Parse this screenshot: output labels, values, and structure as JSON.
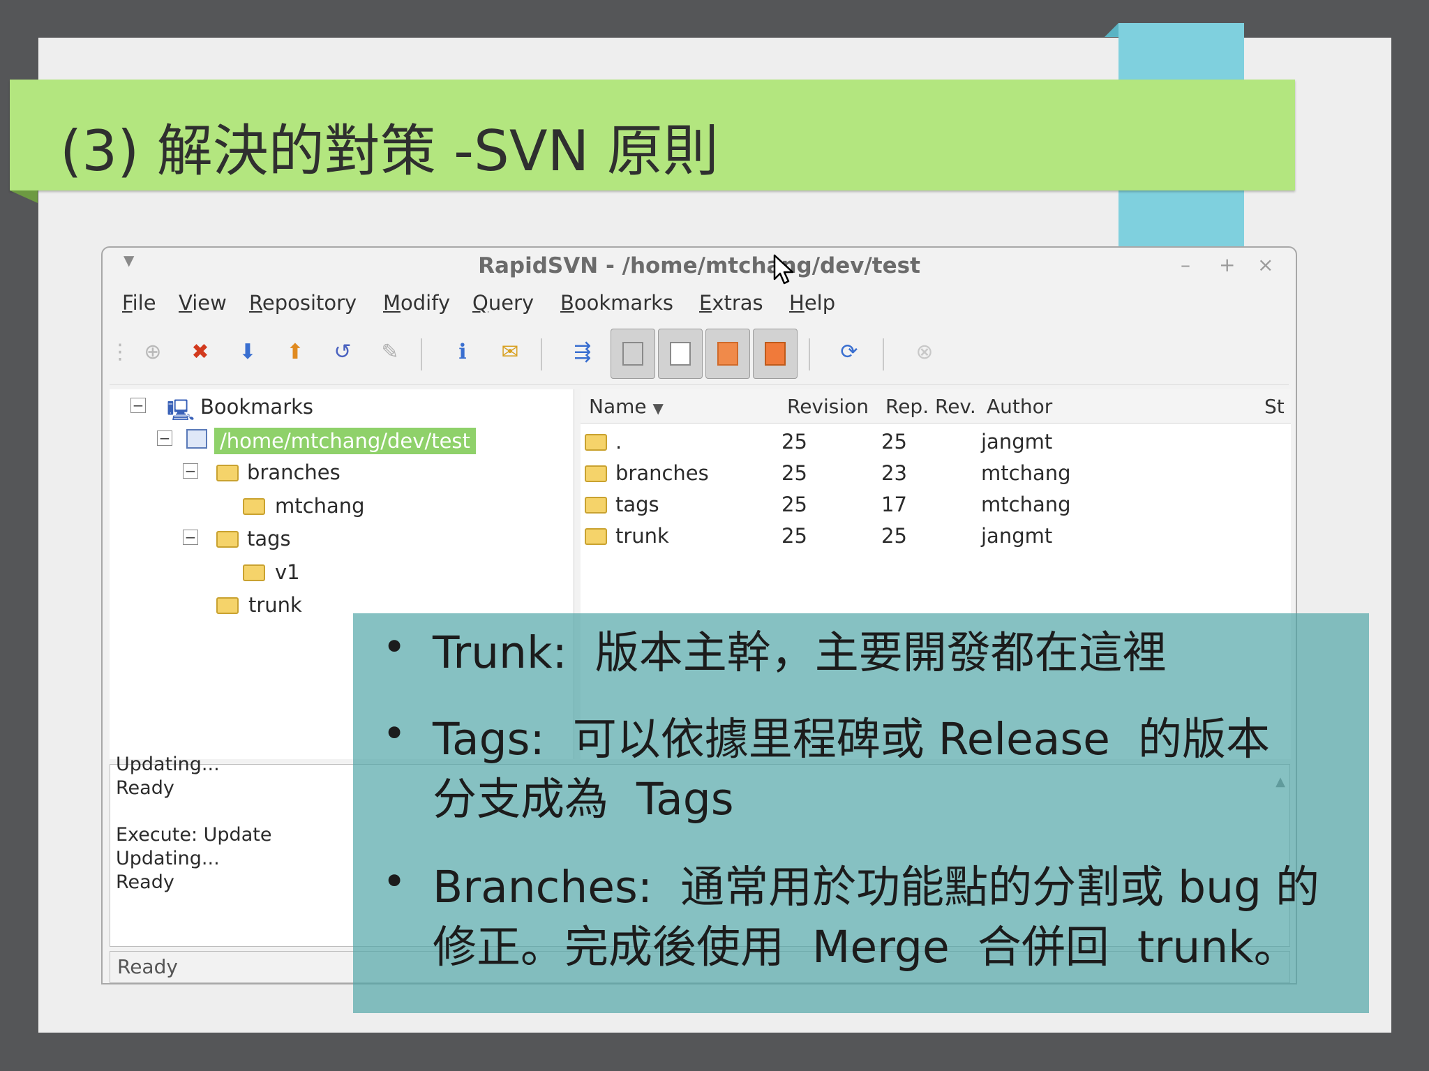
{
  "slide": {
    "title": "(3) 解決的對策 -SVN 原則"
  },
  "window": {
    "title": "RapidSVN - /home/mtchang/dev/test",
    "controls": {
      "minimize": "–",
      "maximize": "+",
      "close": "×"
    }
  },
  "menu": [
    {
      "ul": "F",
      "rest": "ile"
    },
    {
      "ul": "V",
      "rest": "iew"
    },
    {
      "ul": "R",
      "rest": "epository"
    },
    {
      "ul": "M",
      "rest": "odify"
    },
    {
      "ul": "Q",
      "rest": "uery"
    },
    {
      "ul": "B",
      "rest": "ookmarks"
    },
    {
      "ul": "E",
      "rest": "xtras"
    },
    {
      "ul": "H",
      "rest": "elp"
    }
  ],
  "tree": {
    "root": "Bookmarks",
    "bookmark": "/home/mtchang/dev/test",
    "branches": "branches",
    "branches_child": "mtchang",
    "tags": "tags",
    "tags_child": "v1",
    "trunk": "trunk"
  },
  "list": {
    "headers": {
      "name": "Name",
      "revision": "Revision",
      "rep_rev": "Rep. Rev.",
      "author": "Author",
      "status": "St"
    },
    "rows": [
      {
        "name": ".",
        "revision": "25",
        "rep_rev": "25",
        "author": "jangmt"
      },
      {
        "name": "branches",
        "revision": "25",
        "rep_rev": "23",
        "author": "mtchang"
      },
      {
        "name": "tags",
        "revision": "25",
        "rep_rev": "17",
        "author": "mtchang"
      },
      {
        "name": "trunk",
        "revision": "25",
        "rep_rev": "25",
        "author": "jangmt"
      }
    ]
  },
  "log": {
    "lines": [
      "Updating...",
      "Ready",
      "",
      "Execute: Update",
      "Updating...",
      "Ready"
    ]
  },
  "statusbar": {
    "text": "Ready"
  },
  "bullets": [
    {
      "line1": "Trunk:  版本主幹，主要開發都在這裡",
      "line2": ""
    },
    {
      "line1": "Tags:  可以依據里程碑或 Release  的版本",
      "line2": "分支成為  Tags"
    },
    {
      "line1": "Branches:  通常用於功能點的分割或 bug 的",
      "line2": "修正。完成後使用  Merge  合併回  trunk。"
    }
  ],
  "colors": {
    "title_bar": "#b3e67f",
    "accent_block": "#7fd0de",
    "overlay": "#4da3a5",
    "selection": "#8fd16a"
  }
}
